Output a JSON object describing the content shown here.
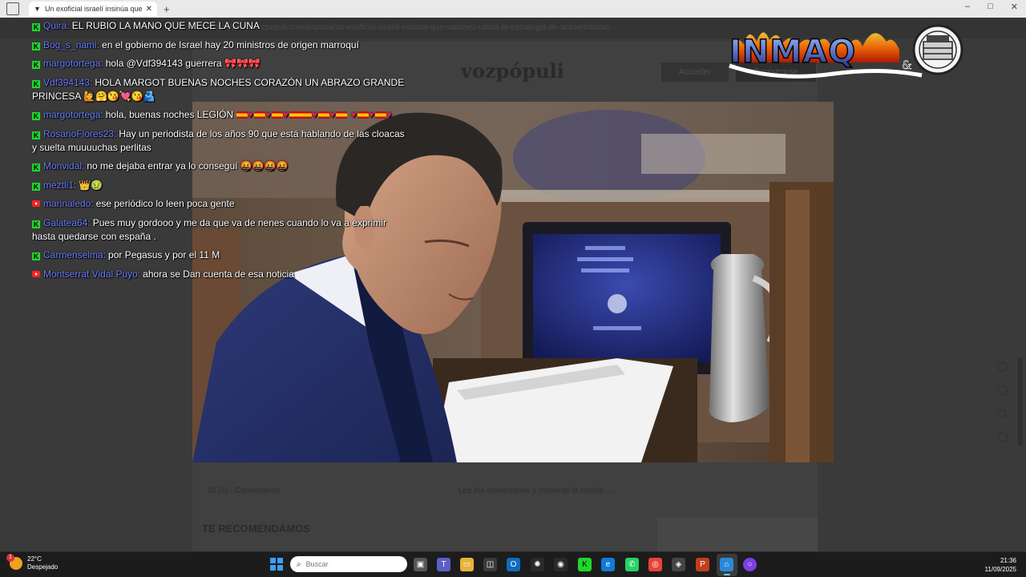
{
  "browser": {
    "tab_title": "Un exoficial israelí insinúa que Sá",
    "url_text": "https://www.vozpopuli.com/espana/un-exoficial-israeli-insinua-que-sanchez-utiliza-la-estrategia-de-antisemitismo..."
  },
  "site": {
    "logo": "vozpópuli",
    "acceder": "Acceder",
    "registro": "Registrarse",
    "comments_count": "10 (6) · Comentarios",
    "comments_cta": "Lee los comentarios y comenta la noticia →",
    "recommend_heading": "TE RECOMENDAMOS"
  },
  "brand": {
    "name": "INMAQ",
    "suffix": "&"
  },
  "chat": [
    {
      "platform": "kick",
      "user": "Quira:",
      "text": "EL RUBIO LA MANO QUE MECE LA CUNA"
    },
    {
      "platform": "kick",
      "user": "Bog_s_nami:",
      "text": "en el gobierno de Israel hay 20 ministros de origen marroquí"
    },
    {
      "platform": "kick",
      "user": "margotortega:",
      "text": "hola @Vdf394143 guerrera 🎀🎀🎀"
    },
    {
      "platform": "kick",
      "user": "Vdf394143:",
      "text": "HOLA MARGOT BUENAS NOCHES CORAZÓN UN ABRAZO GRANDE PRINCESA 🙋🤗😘💘😘🫂"
    },
    {
      "platform": "kick",
      "user": "margotortega:",
      "text": "hola, buenas noches LEGIÓN"
    },
    {
      "platform": "kick",
      "user": "RosarioFlores23:",
      "text": "Hay un periodista de los años 90 que está hablando de las cloacas y suelta muuuuchas perlitas"
    },
    {
      "platform": "kick",
      "user": "Monvidal:",
      "text": "no me dejaba entrar ya lo conseguí 🤬🤬🤬🤬"
    },
    {
      "platform": "kick",
      "user": "meztli1:",
      "text": "👑🤢"
    },
    {
      "platform": "youtube",
      "user": "marinaledo:",
      "text": "ese periódico lo leen poca gente"
    },
    {
      "platform": "kick",
      "user": "Galatea64:",
      "text": "Pues muy gordooo y me da que va de nenes cuando lo va a exprimir hasta quedarse con españa ."
    },
    {
      "platform": "kick",
      "user": "Carmenselma:",
      "text": "por Pegasus y por el 11 M"
    },
    {
      "platform": "youtube",
      "user": "Montserrat Vidal Puyo:",
      "text": "ahora se Dan cuenta de esa noticia"
    }
  ],
  "taskbar": {
    "temperature": "22°C",
    "weather": "Despejado",
    "weather_badge": "1",
    "search_placeholder": "Buscar",
    "time": "21:36",
    "date": "11/09/2025"
  },
  "colors": {
    "username": "#6a7dff",
    "kick_green": "#1fd82a",
    "youtube_red": "#ff2222"
  }
}
